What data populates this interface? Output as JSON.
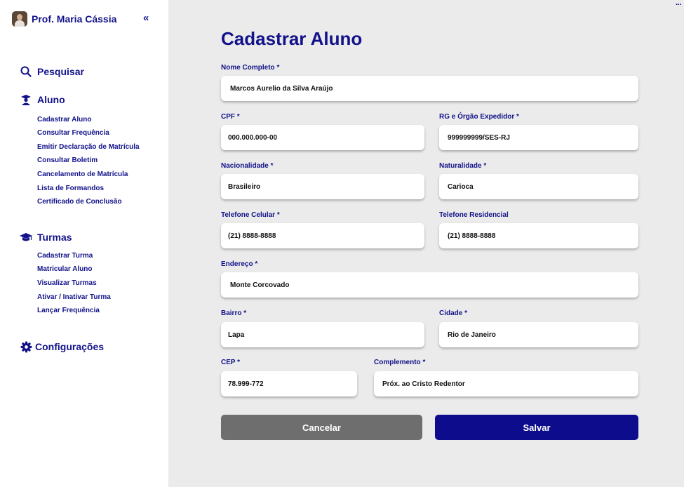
{
  "sidebar": {
    "profile_name": "Prof. Maria Cássia",
    "collapse_icon": "«",
    "search_label": "Pesquisar",
    "aluno": {
      "label": "Aluno",
      "items": [
        "Cadastrar Aluno",
        "Consultar Frequência",
        "Emitir Declaração de Matrícula",
        "Consultar Boletim",
        "Cancelamento de Matrícula",
        "Lista de Formandos",
        "Certificado de Conclusão"
      ]
    },
    "turmas": {
      "label": "Turmas",
      "items": [
        "Cadastrar Turma",
        "Matricular Aluno",
        "Visualizar Turmas",
        "Ativar / Inativar Turma",
        "Lançar Frequência"
      ]
    },
    "config_label": "Configurações"
  },
  "form": {
    "title": "Cadastrar Aluno",
    "nome": {
      "label": "Nome Completo *",
      "value": "Marcos Aurelio da Silva Araújo"
    },
    "cpf": {
      "label": "CPF *",
      "value": "000.000.000-00"
    },
    "rg": {
      "label": "RG e Órgão Expedidor *",
      "value": "999999999/SES-RJ"
    },
    "nacionalidade": {
      "label": "Nacionalidade *",
      "value": "Brasileiro"
    },
    "naturalidade": {
      "label": "Naturalidade *",
      "value": "Carioca"
    },
    "tel_celular": {
      "label": "Telefone Celular *",
      "value": "(21) 8888-8888"
    },
    "tel_residencial": {
      "label": "Telefone Residencial",
      "value": "(21) 8888-8888"
    },
    "endereco": {
      "label": "Endereço *",
      "value": "Monte Corcovado"
    },
    "bairro": {
      "label": "Bairro *",
      "value": "Lapa"
    },
    "cidade": {
      "label": "Cidade *",
      "value": "Rio de Janeiro"
    },
    "cep": {
      "label": "CEP *",
      "value": "78.999-772"
    },
    "complemento": {
      "label": "Complemento *",
      "value": "Próx. ao Cristo Redentor"
    },
    "cancel_label": "Cancelar",
    "save_label": "Salvar"
  },
  "more_icon": "···",
  "colors": {
    "primary": "#0c0c8c",
    "cancel": "#6e6e6e",
    "background": "#ebebeb"
  }
}
